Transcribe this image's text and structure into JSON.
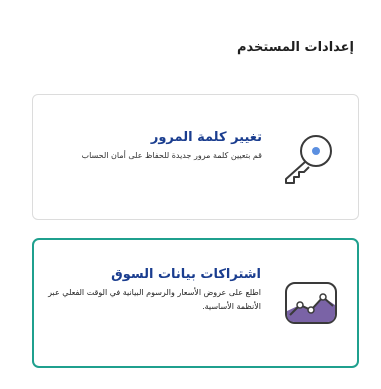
{
  "page": {
    "title": "إعدادات المستخدم"
  },
  "cards": [
    {
      "title": "تغيير كلمة المرور",
      "description": "قم بتعيين كلمة مرور جديدة للحفاظ على أمان الحساب",
      "icon": "key-icon"
    },
    {
      "title": "اشتراكات بيانات السوق",
      "description": "اطلع على عروض الأسعار والرسوم البيانية في الوقت الفعلي عبر الأنظمة الأساسية.",
      "icon": "chart-icon"
    }
  ],
  "colors": {
    "title_blue": "#1a3d8f",
    "selected_border": "#1fa08e",
    "chart_fill": "#7a63a6",
    "key_dot": "#5b8fe0"
  }
}
